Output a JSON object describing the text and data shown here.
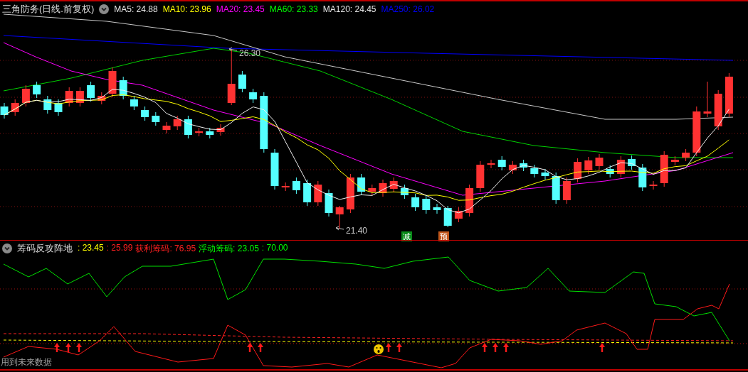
{
  "main_chart": {
    "title": "三角防务(日线.前复权)",
    "ma_legend": [
      {
        "label": "MA5: 24.88",
        "color": "#e6e6e6"
      },
      {
        "label": "MA10: 23.96",
        "color": "#ffff00"
      },
      {
        "label": "MA20: 23.45",
        "color": "#ff00ff"
      },
      {
        "label": "MA60: 23.33",
        "color": "#00ff00"
      },
      {
        "label": "MA120: 24.45",
        "color": "#e6e6e6"
      },
      {
        "label": "MA250: 26.02",
        "color": "#0000ff"
      }
    ],
    "price_labels": [
      {
        "text": "26.30"
      },
      {
        "text": "21.40"
      }
    ],
    "signals": [
      {
        "text": "减",
        "color": "#0a8a1a"
      },
      {
        "text": "预",
        "color": "#c0561a"
      }
    ]
  },
  "indicator": {
    "title": "筹码反攻阵地",
    "values": [
      {
        "label": ": 23.45",
        "color": "#ffff00"
      },
      {
        "label": ": 25.99",
        "color": "#ff2020"
      },
      {
        "label": "获利筹码: 76.95",
        "color": "#ff2020"
      },
      {
        "label": "浮动筹码: 23.05",
        "color": "#00ff00"
      },
      {
        "label": ": 70.00",
        "color": "#00ff00"
      }
    ]
  },
  "footer_note": "用到未来数据"
}
